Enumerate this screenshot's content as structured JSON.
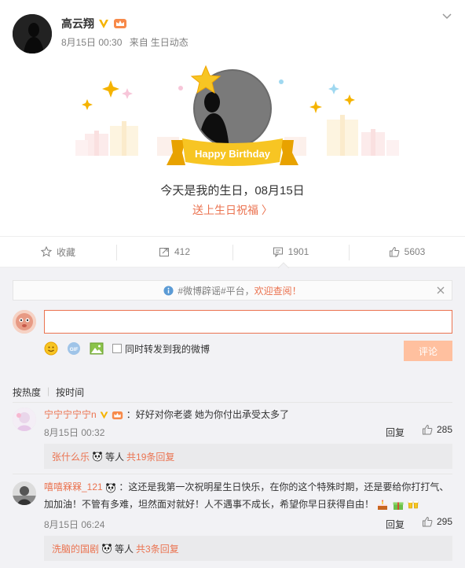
{
  "post": {
    "username": "高云翔",
    "date": "8月15日 00:30",
    "source_prefix": "来自",
    "source": "生日动态",
    "birthday_banner": "Happy Birthday",
    "birthday_text": "今天是我的生日，08月15日",
    "birthday_link": "送上生日祝福 〉"
  },
  "actions": {
    "favorite": "收藏",
    "repost": "412",
    "comment": "1901",
    "like": "5603"
  },
  "notice": {
    "prefix": "#微博辟谣#平台，",
    "highlight": "欢迎查阅！"
  },
  "composer": {
    "input_value": "",
    "sync_label": "同时转发到我的微博",
    "submit_label": "评论"
  },
  "sort": {
    "hot": "按热度",
    "time": "按时间"
  },
  "comments": [
    {
      "user": "宁宁宁宁宁n",
      "text": "：好好对你老婆 她为你付出承受太多了",
      "time": "8月15日 00:32",
      "reply": "回复",
      "likes": "285",
      "sub_user": "张什么乐",
      "sub_mid": "等人",
      "sub_count": "共19条回复"
    },
    {
      "user": "嘻嘻槑槑_121",
      "text_line1": "：这还是我第一次祝明星生日快乐，在你的这个特殊时期，还是要给你打打气、",
      "text_line2": "加加油！不管有多难，坦然面对就好！人不遇事不成长，希望你早日获得自由！",
      "time": "8月15日 06:24",
      "reply": "回复",
      "likes": "295",
      "sub_user": "洗脑的国剧",
      "sub_mid": "等人",
      "sub_count": "共3条回复"
    }
  ],
  "colors": {
    "accent": "#eb7350",
    "button_disabled": "#ffc09f",
    "gold": "#f5b300"
  }
}
